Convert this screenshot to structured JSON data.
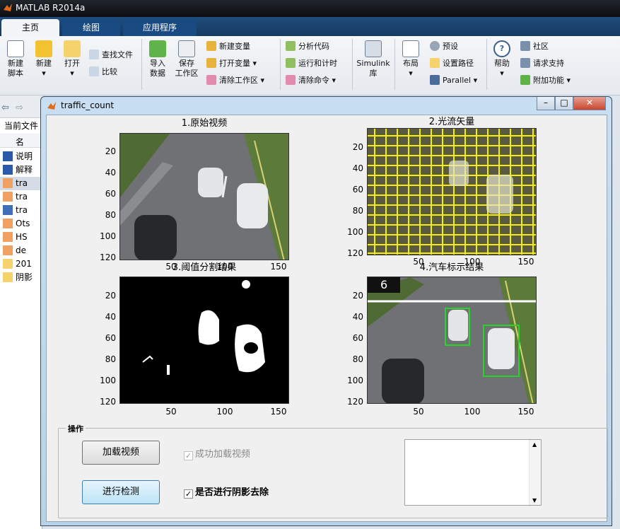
{
  "app": {
    "title": "MATLAB R2014a"
  },
  "tabs": [
    "主页",
    "绘图",
    "应用程序"
  ],
  "ribbon": {
    "new_script": "新建\n脚本",
    "new": "新建",
    "open": "打开",
    "find_files": "查找文件",
    "compare": "比较",
    "import_data": "导入\n数据",
    "save_workspace": "保存\n工作区",
    "new_variable": "新建变量",
    "open_variable": "打开变量",
    "clear_workspace": "清除工作区",
    "analyze_code": "分析代码",
    "run_and_time": "运行和计时",
    "clear_commands": "清除命令",
    "simulink": "Simulink\n库",
    "layout": "布局",
    "preferences": "预设",
    "set_path": "设置路径",
    "parallel": "Parallel",
    "help": "帮助",
    "community": "社区",
    "request_support": "请求支持",
    "add_ons": "附加功能"
  },
  "left_panel": {
    "header": "当前文件",
    "col": "名",
    "items": [
      "说明",
      "解释",
      "tra",
      "tra",
      "tra",
      "Ots",
      "HS",
      "de",
      "201",
      "阴影"
    ]
  },
  "figure": {
    "title": "traffic_count",
    "axes": [
      {
        "title": "1.原始视频"
      },
      {
        "title": "2.光流矢量"
      },
      {
        "title": "3.阈值分割结果"
      },
      {
        "title": "4.汽车标示结果"
      }
    ],
    "yticks": [
      "20",
      "40",
      "60",
      "80",
      "100",
      "120"
    ],
    "xticks": [
      "50",
      "100",
      "150"
    ],
    "car_count": "6",
    "panel_label": "操作",
    "load_button": "加载视频",
    "detect_button": "进行检测",
    "loaded_check": "成功加载视频",
    "shadow_check": "是否进行阴影去除"
  }
}
